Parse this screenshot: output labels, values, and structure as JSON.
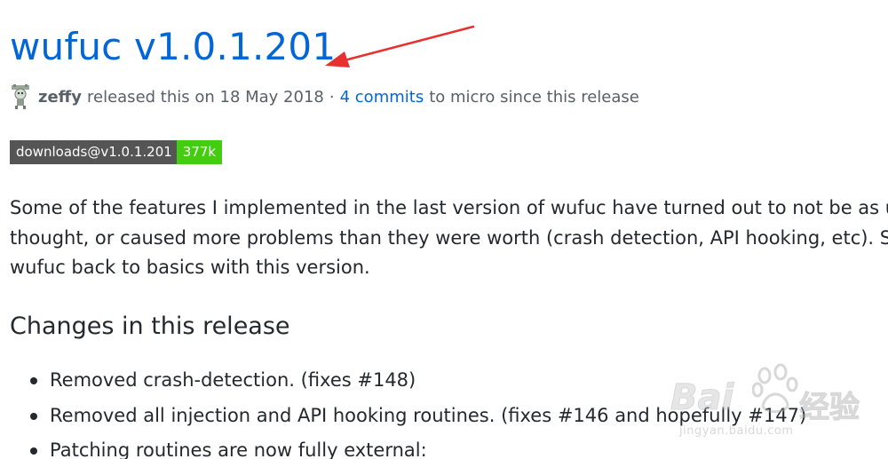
{
  "release": {
    "title": "wufuc v1.0.1.201",
    "author": "zeffy",
    "released_text": "released this on 18 May 2018",
    "separator": "·",
    "commits_link": "4 commits",
    "commits_suffix": "to micro since this release"
  },
  "badge": {
    "label": "downloads@v1.0.1.201",
    "count": "377k",
    "label_color": "#555555",
    "count_color": "#44cc11"
  },
  "description": {
    "lines": [
      "Some of the features I implemented in the last version of wufuc have turned out to not be as usefu",
      "thought, or caused more problems than they were worth (crash detection, API hooking, etc). So I br",
      "wufuc back to basics with this version."
    ]
  },
  "changes": {
    "heading": "Changes in this release",
    "items": [
      "Removed crash-detection. (fixes #148)",
      "Removed all injection and API hooking routines. (fixes #146 and hopefully #147)",
      "Patching routines are now fully external:"
    ]
  },
  "annotation": {
    "arrow_color": "#e8312f"
  },
  "watermark": {
    "brand": "Bai",
    "brand_cn": "经验",
    "url": "jingyan.baidu.com"
  }
}
